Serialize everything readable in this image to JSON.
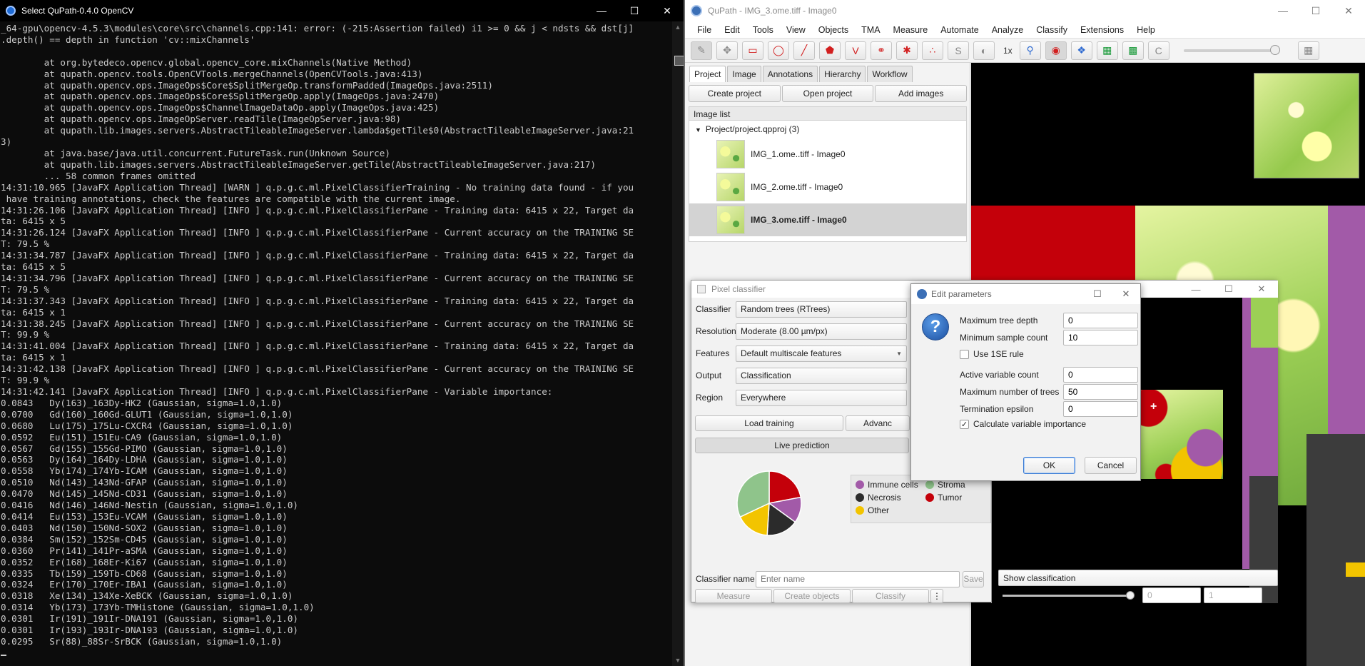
{
  "console": {
    "title": "Select QuPath-0.4.0 OpenCV",
    "lines": "_64-gpu\\opencv-4.5.3\\modules\\core\\src\\channels.cpp:141: error: (-215:Assertion failed) i1 >= 0 && j < ndsts && dst[j]\n.depth() == depth in function 'cv::mixChannels'\n\n        at org.bytedeco.opencv.global.opencv_core.mixChannels(Native Method)\n        at qupath.opencv.tools.OpenCVTools.mergeChannels(OpenCVTools.java:413)\n        at qupath.opencv.ops.ImageOps$Core$SplitMergeOp.transformPadded(ImageOps.java:2511)\n        at qupath.opencv.ops.ImageOps$Core$SplitMergeOp.apply(ImageOps.java:2470)\n        at qupath.opencv.ops.ImageOps$ChannelImageDataOp.apply(ImageOps.java:425)\n        at qupath.opencv.ops.ImageOpServer.readTile(ImageOpServer.java:98)\n        at qupath.lib.images.servers.AbstractTileableImageServer.lambda$getTile$0(AbstractTileableImageServer.java:21\n3)\n        at java.base/java.util.concurrent.FutureTask.run(Unknown Source)\n        at qupath.lib.images.servers.AbstractTileableImageServer.getTile(AbstractTileableImageServer.java:217)\n        ... 58 common frames omitted\n14:31:10.965 [JavaFX Application Thread] [WARN ] q.p.g.c.ml.PixelClassifierTraining - No training data found - if you\n have training annotations, check the features are compatible with the current image.\n14:31:26.106 [JavaFX Application Thread] [INFO ] q.p.g.c.ml.PixelClassifierPane - Training data: 6415 x 22, Target da\nta: 6415 x 5\n14:31:26.124 [JavaFX Application Thread] [INFO ] q.p.g.c.ml.PixelClassifierPane - Current accuracy on the TRAINING SE\nT: 79.5 %\n14:31:34.787 [JavaFX Application Thread] [INFO ] q.p.g.c.ml.PixelClassifierPane - Training data: 6415 x 22, Target da\nta: 6415 x 5\n14:31:34.796 [JavaFX Application Thread] [INFO ] q.p.g.c.ml.PixelClassifierPane - Current accuracy on the TRAINING SE\nT: 79.5 %\n14:31:37.343 [JavaFX Application Thread] [INFO ] q.p.g.c.ml.PixelClassifierPane - Training data: 6415 x 22, Target da\nta: 6415 x 1\n14:31:38.245 [JavaFX Application Thread] [INFO ] q.p.g.c.ml.PixelClassifierPane - Current accuracy on the TRAINING SE\nT: 99.9 %\n14:31:41.004 [JavaFX Application Thread] [INFO ] q.p.g.c.ml.PixelClassifierPane - Training data: 6415 x 22, Target da\nta: 6415 x 1\n14:31:42.138 [JavaFX Application Thread] [INFO ] q.p.g.c.ml.PixelClassifierPane - Current accuracy on the TRAINING SE\nT: 99.9 %\n14:31:42.141 [JavaFX Application Thread] [INFO ] q.p.g.c.ml.PixelClassifierPane - Variable importance:\n0.0843   Dy(163)_163Dy-HK2 (Gaussian, sigma=1.0,1.0)\n0.0700   Gd(160)_160Gd-GLUT1 (Gaussian, sigma=1.0,1.0)\n0.0680   Lu(175)_175Lu-CXCR4 (Gaussian, sigma=1.0,1.0)\n0.0592   Eu(151)_151Eu-CA9 (Gaussian, sigma=1.0,1.0)\n0.0567   Gd(155)_155Gd-PIMO (Gaussian, sigma=1.0,1.0)\n0.0563   Dy(164)_164Dy-LDHA (Gaussian, sigma=1.0,1.0)\n0.0558   Yb(174)_174Yb-ICAM (Gaussian, sigma=1.0,1.0)\n0.0510   Nd(143)_143Nd-GFAP (Gaussian, sigma=1.0,1.0)\n0.0470   Nd(145)_145Nd-CD31 (Gaussian, sigma=1.0,1.0)\n0.0416   Nd(146)_146Nd-Nestin (Gaussian, sigma=1.0,1.0)\n0.0414   Eu(153)_153Eu-VCAM (Gaussian, sigma=1.0,1.0)\n0.0403   Nd(150)_150Nd-SOX2 (Gaussian, sigma=1.0,1.0)\n0.0384   Sm(152)_152Sm-CD45 (Gaussian, sigma=1.0,1.0)\n0.0360   Pr(141)_141Pr-aSMA (Gaussian, sigma=1.0,1.0)\n0.0352   Er(168)_168Er-Ki67 (Gaussian, sigma=1.0,1.0)\n0.0335   Tb(159)_159Tb-CD68 (Gaussian, sigma=1.0,1.0)\n0.0324   Er(170)_170Er-IBA1 (Gaussian, sigma=1.0,1.0)\n0.0318   Xe(134)_134Xe-XeBCK (Gaussian, sigma=1.0,1.0)\n0.0314   Yb(173)_173Yb-TMHistone (Gaussian, sigma=1.0,1.0)\n0.0301   Ir(191)_191Ir-DNA191 (Gaussian, sigma=1.0,1.0)\n0.0301   Ir(193)_193Ir-DNA193 (Gaussian, sigma=1.0,1.0)\n0.0295   Sr(88)_88Sr-SrBCK (Gaussian, sigma=1.0,1.0)"
  },
  "qupath": {
    "title": "QuPath - IMG_3.ome.tiff - Image0",
    "menu": [
      "File",
      "Edit",
      "Tools",
      "View",
      "Objects",
      "TMA",
      "Measure",
      "Automate",
      "Analyze",
      "Classify",
      "Extensions",
      "Help"
    ],
    "toolbar": {
      "zoom_label": "1x"
    },
    "tabs": [
      "Project",
      "Image",
      "Annotations",
      "Hierarchy",
      "Workflow"
    ],
    "project_buttons": [
      "Create project",
      "Open project",
      "Add images"
    ],
    "image_list_header": "Image list",
    "project_root": "Project/project.qpproj (3)",
    "images": [
      "IMG_1.ome..tiff - Image0",
      "IMG_2.ome.tiff - Image0",
      "IMG_3.ome.tiff - Image0"
    ]
  },
  "pixel_classifier": {
    "title": "Pixel classifier",
    "classifier_label": "Classifier",
    "classifier_value": "Random trees (RTrees)",
    "resolution_label": "Resolution",
    "resolution_value": "Moderate (8.00 µm/px)",
    "features_label": "Features",
    "features_value": "Default multiscale features",
    "output_label": "Output",
    "output_value": "Classification",
    "region_label": "Region",
    "region_value": "Everywhere",
    "load_training": "Load training",
    "advanced": "Advanc",
    "live_prediction": "Live prediction",
    "legend": [
      {
        "name": "Immune cells",
        "color": "#a25aa8"
      },
      {
        "name": "Stroma",
        "color": "#8fc48b"
      },
      {
        "name": "Necrosis",
        "color": "#2b2b2b"
      },
      {
        "name": "Tumor",
        "color": "#c4000a"
      },
      {
        "name": "Other",
        "color": "#f2c400"
      }
    ],
    "pie": [
      {
        "name": "Tumor",
        "value": 0.22,
        "color": "#c4000a"
      },
      {
        "name": "Immune cells",
        "value": 0.13,
        "color": "#a25aa8"
      },
      {
        "name": "Necrosis",
        "value": 0.16,
        "color": "#2b2b2b"
      },
      {
        "name": "Other",
        "value": 0.17,
        "color": "#f2c400"
      },
      {
        "name": "Stroma",
        "value": 0.32,
        "color": "#8fc48b"
      }
    ],
    "classifier_name_label": "Classifier name",
    "classifier_name_placeholder": "Enter name",
    "save": "Save",
    "show_classification": "Show classification",
    "measure": "Measure",
    "create_objects": "Create objects",
    "classify": "Classify",
    "more": "⋮",
    "spin1": "0",
    "spin2": "1"
  },
  "edit_params": {
    "title": "Edit parameters",
    "fields": [
      {
        "label": "Maximum tree depth",
        "value": "0"
      },
      {
        "label": "Minimum sample count",
        "value": "10"
      },
      {
        "label": "Active variable count",
        "value": "0"
      },
      {
        "label": "Maximum number of trees",
        "value": "50"
      },
      {
        "label": "Termination epsilon",
        "value": "0"
      }
    ],
    "use_1se_label": "Use 1SE rule",
    "calc_importance_label": "Calculate variable importance",
    "ok": "OK",
    "cancel": "Cancel"
  }
}
